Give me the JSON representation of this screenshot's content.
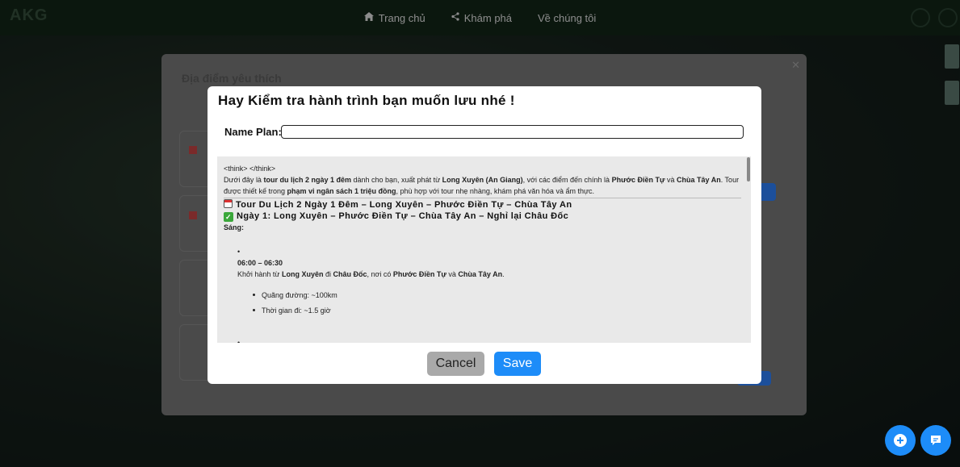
{
  "nav": {
    "logo": "AKG",
    "items": [
      {
        "label": "Trang chủ",
        "icon": "home-icon"
      },
      {
        "label": "Khám phá",
        "icon": "share-icon"
      },
      {
        "label": "Về chúng tôi",
        "icon": ""
      }
    ]
  },
  "background_panel": {
    "title": "Địa điểm yêu thích"
  },
  "modal": {
    "title": "Hay Kiểm tra hành trình bạn muốn lưu nhé !",
    "name_label": "Name Plan:",
    "name_value": "",
    "think": "<think> </think>",
    "intro": {
      "p1": "Dưới đây là ",
      "b1": "tour du lịch 2 ngày 1 đêm",
      "p2": " dành cho bạn, xuất phát từ ",
      "b2": "Long Xuyên (An Giang)",
      "p3": ", với các điểm đến chính là ",
      "b3": "Phước Điền Tự",
      "p4": " và ",
      "b4": "Chùa Tây An",
      "p5": ". Tour được thiết kế trong ",
      "b5": "phạm vi ngân sách 1 triệu đồng",
      "p6": ", phù hợp với tour nhẹ nhàng, khám phá văn hóa và ẩm thực."
    },
    "heading1": "Tour Du Lịch 2 Ngày 1 Đêm – Long Xuyên – Phước Điền Tự – Chùa Tây An",
    "heading2": "Ngày 1: Long Xuyên – Phước Điền Tự – Chùa Tây An – Nghỉ lại Châu Đốc",
    "session": "Sáng:",
    "time": "06:00 – 06:30",
    "item": {
      "p1": "Khởi hành từ ",
      "b1": "Long Xuyên",
      "p2": " đi ",
      "b2": "Châu Đốc",
      "p3": ", nơi có ",
      "b3": "Phước Điền Tự",
      "p4": " và ",
      "b4": "Chùa Tây An",
      "p5": "."
    },
    "sub_items": [
      "Quãng đường: ~100km",
      "Thời gian đi: ~1.5 giờ"
    ],
    "cancel_label": "Cancel",
    "save_label": "Save"
  },
  "fab": {
    "add_icon": "add-circle-icon",
    "chat_icon": "chat-icon"
  },
  "colors": {
    "primary": "#1d8cf8",
    "cancel_bg": "#a9a9a9",
    "nav_bg": "#152a1b"
  }
}
